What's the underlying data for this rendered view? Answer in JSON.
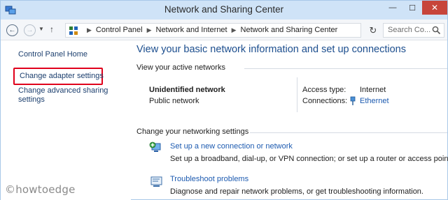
{
  "window": {
    "title": "Network and Sharing Center",
    "controls": {
      "minimize": "—",
      "maximize": "☐",
      "close": "✕"
    }
  },
  "navbar": {
    "back_icon": "back-arrow-icon",
    "forward_icon": "forward-arrow-icon",
    "breadcrumb": [
      "Control Panel",
      "Network and Internet",
      "Network and Sharing Center"
    ],
    "search_placeholder": "Search Co..."
  },
  "sidebar": {
    "home": "Control Panel Home",
    "items": [
      {
        "label": "Change adapter settings",
        "highlighted": true
      },
      {
        "label": "Change advanced sharing settings"
      }
    ]
  },
  "main": {
    "heading": "View your basic network information and set up connections",
    "active_networks": {
      "title": "View your active networks",
      "network_name": "Unidentified network",
      "network_type": "Public network",
      "access_type_label": "Access type:",
      "access_type_value": "Internet",
      "connections_label": "Connections:",
      "connections_value": "Ethernet"
    },
    "settings": {
      "title": "Change your networking settings",
      "tasks": [
        {
          "link": "Set up a new connection or network",
          "description": "Set up a broadband, dial-up, or VPN connection; or set up a router or access point."
        },
        {
          "link": "Troubleshoot problems",
          "description": "Diagnose and repair network problems, or get troubleshooting information."
        }
      ]
    }
  },
  "watermark": "©howtoedge",
  "colors": {
    "accent": "#1c4e8e",
    "link": "#1c5ab0",
    "highlight_box": "#e0001b",
    "titlebar": "#cfe3f7",
    "close_button": "#c7453b"
  }
}
